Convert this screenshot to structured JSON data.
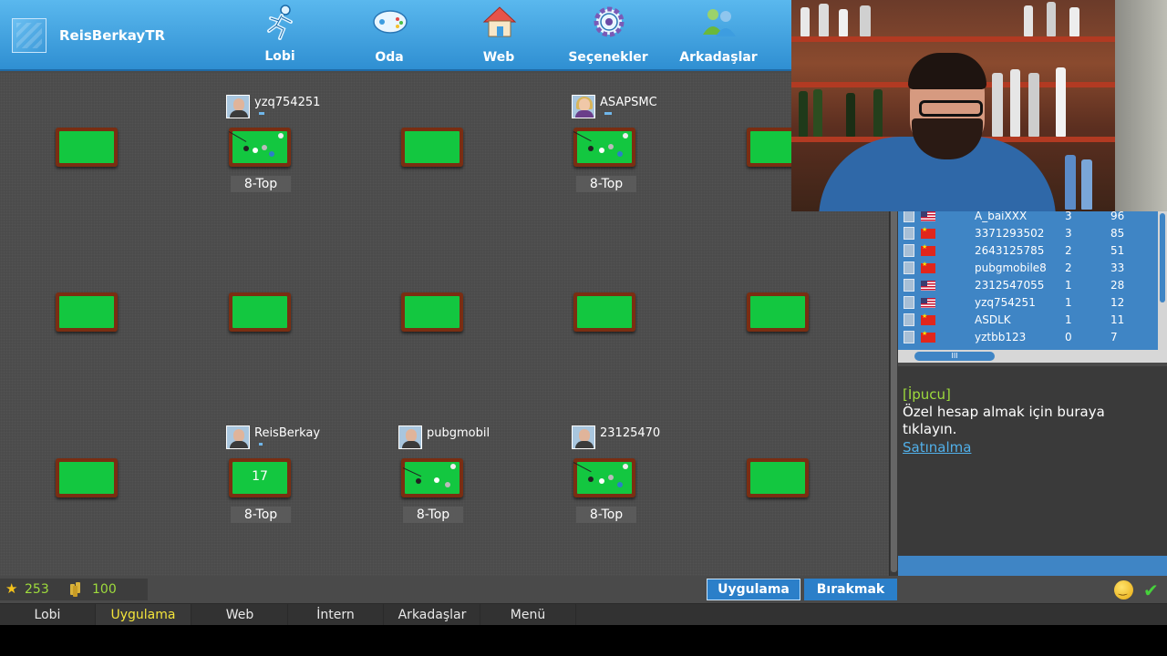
{
  "header": {
    "username": "ReisBerkayTR",
    "nav": [
      {
        "label": "Lobi",
        "icon": "runner-icon"
      },
      {
        "label": "Oda",
        "icon": "gamepad-icon"
      },
      {
        "label": "Web",
        "icon": "house-icon"
      },
      {
        "label": "Seçenekler",
        "icon": "gear-icon"
      },
      {
        "label": "Arkadaşlar",
        "icon": "friends-icon"
      }
    ]
  },
  "lobby": {
    "game_label": "8-Top",
    "seats": [
      {
        "player": "yzq754251",
        "avatar": "male"
      },
      {
        "player": "ASAPSMC",
        "avatar": "female"
      },
      {
        "player": "ReisBerkay",
        "avatar": "male"
      },
      {
        "player": "pubgmobil",
        "avatar": "male"
      },
      {
        "player": "23125470",
        "avatar": "male"
      }
    ],
    "table_number": "17"
  },
  "player_list": {
    "rows": [
      {
        "name": "A_baiXXX",
        "flag": "us",
        "rank": "3",
        "score": "96"
      },
      {
        "name": "3371293502",
        "flag": "cn",
        "rank": "3",
        "score": "85"
      },
      {
        "name": "2643125785",
        "flag": "cn",
        "rank": "2",
        "score": "51"
      },
      {
        "name": "pubgmobile8",
        "flag": "cn",
        "rank": "2",
        "score": "33"
      },
      {
        "name": "2312547055",
        "flag": "us",
        "rank": "1",
        "score": "28"
      },
      {
        "name": "yzq754251",
        "flag": "us",
        "rank": "1",
        "score": "12"
      },
      {
        "name": "ASDLK",
        "flag": "cn",
        "rank": "1",
        "score": "11"
      },
      {
        "name": "yztbb123",
        "flag": "cn",
        "rank": "0",
        "score": "7"
      }
    ],
    "hscroll_grip": "III"
  },
  "chat": {
    "tip_label": "[İpucu]",
    "message_line1": "Özel hesap almak için buraya",
    "message_line2": "tıklayın.",
    "link": "Satınalma"
  },
  "stats": {
    "stars": "253",
    "coins": "100"
  },
  "buttons": {
    "uygulama": "Uygulama",
    "birakmak": "Bırakmak"
  },
  "tabs": [
    {
      "label": "Lobi",
      "active": false
    },
    {
      "label": "Uygulama",
      "active": true
    },
    {
      "label": "Web",
      "active": false
    },
    {
      "label": "İntern",
      "active": false
    },
    {
      "label": "Arkadaşlar",
      "active": false
    },
    {
      "label": "Menü",
      "active": false
    }
  ],
  "colors": {
    "accent_blue": "#2b7fc9",
    "felt_green": "#13c740",
    "highlight_green": "#9edb3c",
    "active_tab": "#f3e43a"
  }
}
